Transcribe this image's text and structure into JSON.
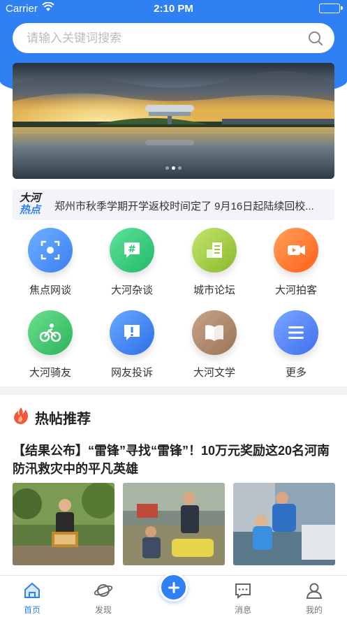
{
  "status_bar": {
    "carrier": "Carrier",
    "time": "2:10 PM"
  },
  "search": {
    "placeholder": "请输入关键词搜索"
  },
  "hot_news": {
    "logo_line1": "大河",
    "logo_line2": "热点",
    "text": "郑州市秋季学期开学返校时间定了 9月16日起陆续回校..."
  },
  "grid": [
    {
      "label": "焦点网谈",
      "icon": "focus-icon",
      "color": "#4a8ff5"
    },
    {
      "label": "大河杂谈",
      "icon": "chat-hash-icon",
      "color": "#2fc97a"
    },
    {
      "label": "城市论坛",
      "icon": "forum-icon",
      "color": "#9bc83a"
    },
    {
      "label": "大河拍客",
      "icon": "video-icon",
      "color": "#ff7a2e"
    },
    {
      "label": "大河骑友",
      "icon": "cyclist-icon",
      "color": "#3ec46a"
    },
    {
      "label": "网友投诉",
      "icon": "complaint-icon",
      "color": "#3c82f0"
    },
    {
      "label": "大河文学",
      "icon": "book-icon",
      "color": "#b28a6a"
    },
    {
      "label": "更多",
      "icon": "menu-icon",
      "color": "#4d7ff4"
    }
  ],
  "section": {
    "title": "热帖推荐"
  },
  "post": {
    "title": "【结果公布】“雷锋”寻找“雷锋”！10万元奖励这20名河南防汛救灾中的平凡英雄"
  },
  "tab_bar": {
    "tabs": [
      {
        "label": "首页",
        "icon": "home-icon",
        "active": true
      },
      {
        "label": "发现",
        "icon": "planet-icon",
        "active": false
      },
      {
        "label": "消息",
        "icon": "message-icon",
        "active": false
      },
      {
        "label": "我的",
        "icon": "profile-icon",
        "active": false
      }
    ]
  },
  "colors": {
    "primary": "#2f80f3",
    "battery": "#4cd964"
  }
}
